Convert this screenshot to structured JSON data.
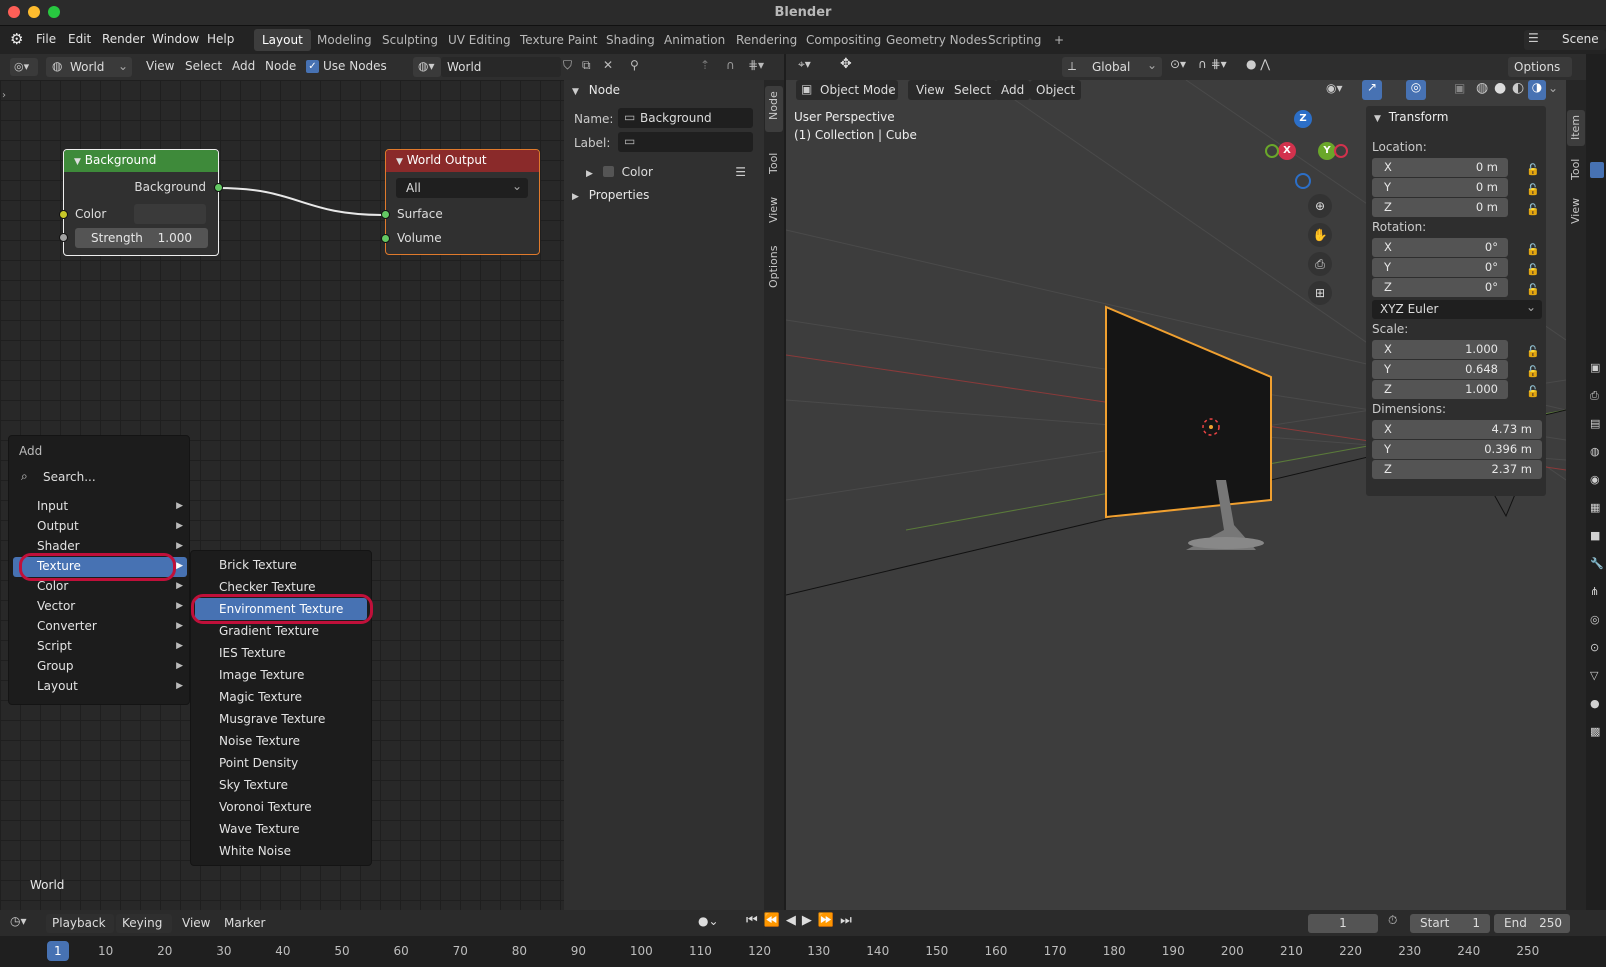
{
  "window": {
    "title": "Blender"
  },
  "menubar": {
    "items": [
      "File",
      "Edit",
      "Render",
      "Window",
      "Help"
    ]
  },
  "workspaces": {
    "tabs": [
      "Layout",
      "Modeling",
      "Sculpting",
      "UV Editing",
      "Texture Paint",
      "Shading",
      "Animation",
      "Rendering",
      "Compositing",
      "Geometry Nodes",
      "Scripting"
    ],
    "active": "Layout",
    "add": "+",
    "scene_label": "Scene"
  },
  "node_editor": {
    "header": {
      "type": "World",
      "menus": [
        "View",
        "Select",
        "Add",
        "Node"
      ],
      "use_nodes": "Use Nodes",
      "world_name": "World"
    },
    "nodes": {
      "background": {
        "title": "Background",
        "output": "Background",
        "color": "Color",
        "strength_label": "Strength",
        "strength_value": "1.000"
      },
      "world_output": {
        "title": "World Output",
        "target": "All",
        "surface": "Surface",
        "volume": "Volume"
      }
    },
    "footer_label": "World"
  },
  "sidebar": {
    "panel": "Node",
    "name_label": "Name:",
    "name_value": "Background",
    "label_label": "Label:",
    "color": "Color",
    "properties": "Properties",
    "tabs": [
      "Node",
      "Tool",
      "View",
      "Options"
    ]
  },
  "add_menu": {
    "title": "Add",
    "search": "Search...",
    "items": [
      "Input",
      "Output",
      "Shader",
      "Texture",
      "Color",
      "Vector",
      "Converter",
      "Script",
      "Group",
      "Layout"
    ],
    "highlighted": "Texture",
    "texture_items": [
      "Brick Texture",
      "Checker Texture",
      "Environment Texture",
      "Gradient Texture",
      "IES Texture",
      "Image Texture",
      "Magic Texture",
      "Musgrave Texture",
      "Noise Texture",
      "Point Density",
      "Sky Texture",
      "Voronoi Texture",
      "Wave Texture",
      "White Noise"
    ],
    "texture_highlighted": "Environment Texture"
  },
  "viewport": {
    "mode": "Object Mode",
    "menus": [
      "View",
      "Select",
      "Add",
      "Object"
    ],
    "transform_orientation": "Global",
    "options": "Options",
    "overlay_text": [
      "User Perspective",
      "(1) Collection | Cube"
    ],
    "axes": {
      "x": "X",
      "y": "Y",
      "z": "Z"
    },
    "n_panel": {
      "title": "Transform",
      "tabs": [
        "Item",
        "Tool",
        "View"
      ],
      "location": {
        "label": "Location:",
        "x": "0 m",
        "y": "0 m",
        "z": "0 m"
      },
      "rotation": {
        "label": "Rotation:",
        "x": "0°",
        "y": "0°",
        "z": "0°",
        "mode": "XYZ Euler"
      },
      "scale": {
        "label": "Scale:",
        "x": "1.000",
        "y": "0.648",
        "z": "1.000"
      },
      "dimensions": {
        "label": "Dimensions:",
        "x": "4.73 m",
        "y": "0.396 m",
        "z": "2.37 m"
      }
    }
  },
  "timeline": {
    "menus": [
      "Playback",
      "Keying",
      "View",
      "Marker"
    ],
    "current_frame": "1",
    "start_label": "Start",
    "start": "1",
    "end_label": "End",
    "end": "250",
    "ticks": [
      "1",
      "10",
      "20",
      "30",
      "40",
      "50",
      "60",
      "70",
      "80",
      "90",
      "100",
      "110",
      "120",
      "130",
      "140",
      "150",
      "160",
      "170",
      "180",
      "190",
      "200",
      "210",
      "220",
      "230",
      "240",
      "250"
    ]
  },
  "colors": {
    "accent": "#4772b3",
    "selection": "#f0a030",
    "highlight_ring": "#c0103a",
    "bg_node": "#3e8a3a",
    "out_node": "#8a2a2a"
  }
}
